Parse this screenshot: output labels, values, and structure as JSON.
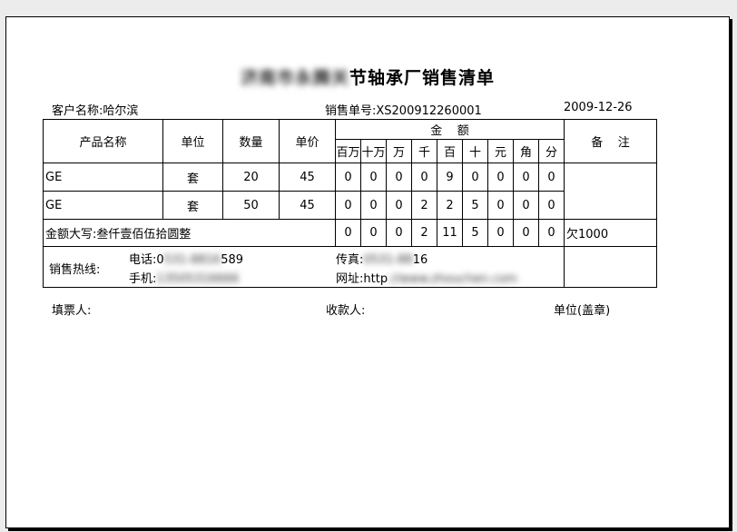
{
  "title": {
    "blurred": "济南市永腾关",
    "visible": "节轴承厂销售清单"
  },
  "header": {
    "customer": "客户名称:哈尔滨",
    "order_no": "销售单号:XS200912260001",
    "date": "2009-12-26"
  },
  "columns": {
    "name": "产品名称",
    "unit": "单位",
    "qty": "数量",
    "price": "单价",
    "amount": "金    额",
    "note": "备    注",
    "digits": [
      "百万",
      "十万",
      "万",
      "千",
      "百",
      "十",
      "元",
      "角",
      "分"
    ]
  },
  "rows": [
    {
      "name": "GE",
      "unit": "套",
      "qty": "20",
      "price": "45",
      "digits": [
        "0",
        "0",
        "0",
        "0",
        "9",
        "0",
        "0",
        "0",
        "0"
      ]
    },
    {
      "name": "GE",
      "unit": "套",
      "qty": "50",
      "price": "45",
      "digits": [
        "0",
        "0",
        "0",
        "2",
        "2",
        "5",
        "0",
        "0",
        "0"
      ]
    }
  ],
  "total": {
    "caps": "金额大写:叁仟壹佰伍拾圆整",
    "digits": [
      "0",
      "0",
      "0",
      "2",
      "11",
      "5",
      "0",
      "0",
      "0"
    ],
    "note": "欠1000"
  },
  "contact": {
    "hotline_label": "销售热线:",
    "phone_label": "电话:",
    "phone_visible_start": "0",
    "phone_blurred": "531-8816",
    "phone_visible_end": "589",
    "mobile_label": "手机:",
    "mobile_blurred": "13505316666",
    "fax_label": "传真:",
    "fax_blurred": "0531-88",
    "fax_visible_end": "16",
    "url_label": "网址:",
    "url_visible": "http",
    "url_blurred": "://www.zhouchen.com"
  },
  "footer": {
    "filler": "填票人:",
    "payee": "收款人:",
    "stamp": "单位(盖章)"
  }
}
